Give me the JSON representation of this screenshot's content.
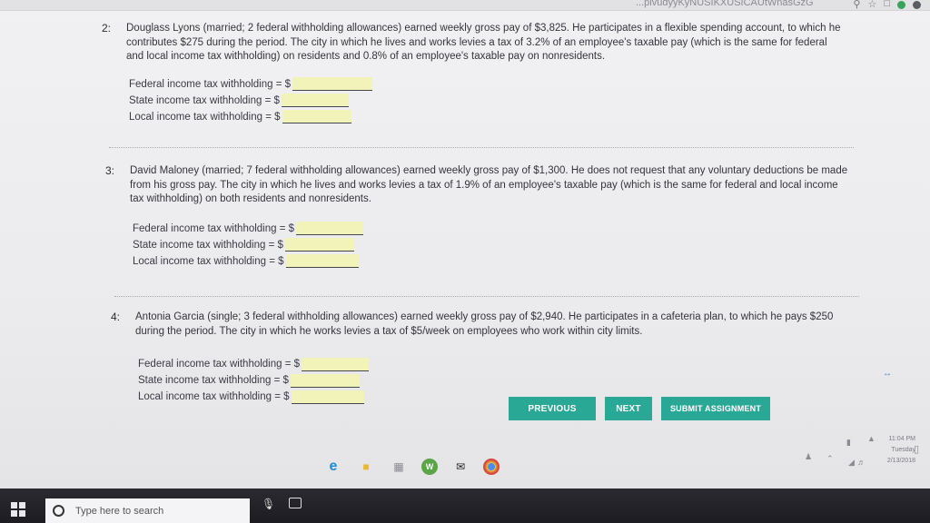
{
  "browser": {
    "url_fragment": "...pivudyyKyNUSIKXUSICAUtWnasGzG",
    "icons": [
      "search-icon",
      "star-icon",
      "extension-icon",
      "extension-icon-2",
      "extension-icon-3"
    ]
  },
  "questions": [
    {
      "number": "2:",
      "text": "Douglass Lyons (married; 2 federal withholding allowances) earned weekly gross pay of $3,825. He participates in a flexible spending account, to which he contributes $275 during the period. The city in which he lives and works levies a tax of 3.2% of an employee's taxable pay (which is the same for federal and local income tax withholding) on residents and 0.8% of an employee's taxable pay on nonresidents.",
      "answers": [
        {
          "label": "Federal income tax withholding = $",
          "value": ""
        },
        {
          "label": "State income tax withholding = $",
          "value": ""
        },
        {
          "label": "Local income tax withholding = $",
          "value": ""
        }
      ]
    },
    {
      "number": "3:",
      "text": "David Maloney (married; 7 federal withholding allowances) earned weekly gross pay of $1,300. He does not request that any voluntary deductions be made from his gross pay. The city in which he lives and works levies a tax of 1.9% of an employee's taxable pay (which is the same for federal and local income tax withholding) on both residents and nonresidents.",
      "answers": [
        {
          "label": "Federal income tax withholding = $",
          "value": ""
        },
        {
          "label": "State income tax withholding = $",
          "value": ""
        },
        {
          "label": "Local income tax withholding = $",
          "value": ""
        }
      ]
    },
    {
      "number": "4:",
      "text": "Antonia Garcia (single; 3 federal withholding allowances) earned weekly gross pay of $2,940. He participates in a cafeteria plan, to which he pays $250 during the period. The city in which he works levies a tax of $5/week on employees who work within city limits.",
      "answers": [
        {
          "label": "Federal income tax withholding = $",
          "value": ""
        },
        {
          "label": "State income tax withholding = $",
          "value": ""
        },
        {
          "label": "Local income tax withholding = $",
          "value": ""
        }
      ]
    }
  ],
  "buttons": {
    "previous": "PREVIOUS",
    "next": "NEXT",
    "submit": "SUBMIT ASSIGNMENT"
  },
  "tray": {
    "time": "11:04 PM",
    "day": "Tuesday",
    "date": "2/13/2018"
  },
  "taskbar": {
    "search_placeholder": "Type here to search",
    "apps": [
      "edge-icon",
      "file-explorer-icon",
      "store-icon",
      "word-online-icon",
      "mail-icon",
      "chrome-icon"
    ]
  },
  "colors": {
    "button": "#2aa896",
    "answer_field": "#f1f3b8",
    "taskbar": "#1f1f25"
  }
}
